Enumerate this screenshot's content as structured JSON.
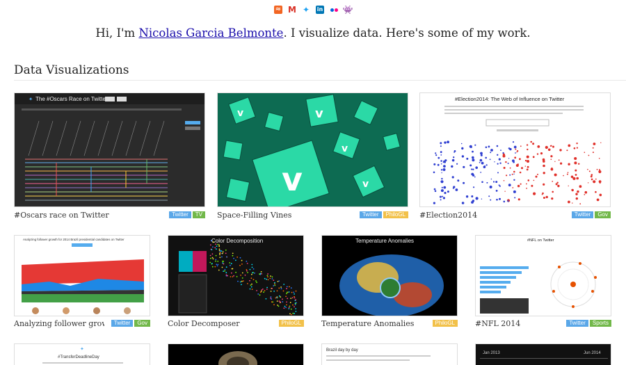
{
  "social": {
    "items": [
      {
        "name": "rss-icon",
        "glyph": "≈"
      },
      {
        "name": "gmail-icon",
        "glyph": "M"
      },
      {
        "name": "twitter-icon",
        "glyph": "✦"
      },
      {
        "name": "linkedin-icon",
        "glyph": "in"
      },
      {
        "name": "flickr-icon",
        "glyph": ""
      },
      {
        "name": "invader-icon",
        "glyph": "👾"
      }
    ]
  },
  "intro": {
    "prefix": "Hi, I'm ",
    "name": "Nicolas Garcia Belmonte",
    "suffix": ". I visualize data. Here's some of my work."
  },
  "section": {
    "title": "Data Visualizations"
  },
  "cards": [
    {
      "caption": "#Oscars race on Twitter",
      "tags": [
        {
          "label": "Twitter",
          "color": "#5aa7e8"
        },
        {
          "label": "TV",
          "color": "#72b84a"
        }
      ],
      "thumb_title": "The #Oscars Race on Twitter"
    },
    {
      "caption": "Space-Filling Vines",
      "tags": [
        {
          "label": "Twitter",
          "color": "#5aa7e8"
        },
        {
          "label": "PhiloGL",
          "color": "#f2c14a"
        }
      ],
      "thumb_title": ""
    },
    {
      "caption": "#Election2014",
      "tags": [
        {
          "label": "Twitter",
          "color": "#5aa7e8"
        },
        {
          "label": "Gov",
          "color": "#72b84a"
        }
      ],
      "thumb_title": "#Election2014: The Web of Influence on Twitter"
    },
    {
      "caption": "Analyzing follower growt…",
      "tags": [
        {
          "label": "Twitter",
          "color": "#5aa7e8"
        },
        {
          "label": "Gov",
          "color": "#72b84a"
        }
      ],
      "thumb_title": "Analyzing follower growth for 2014 Brazil presidential candidates on Twitter"
    },
    {
      "caption": "Color Decomposer",
      "tags": [
        {
          "label": "PhiloGL",
          "color": "#f2c14a"
        }
      ],
      "thumb_title": "Color Decomposition"
    },
    {
      "caption": "Temperature Anomalies",
      "tags": [
        {
          "label": "PhiloGL",
          "color": "#f2c14a"
        }
      ],
      "thumb_title": "Temperature Anomalies"
    },
    {
      "caption": "#NFL 2014",
      "tags": [
        {
          "label": "Twitter",
          "color": "#5aa7e8"
        },
        {
          "label": "Sports",
          "color": "#72b84a"
        }
      ],
      "thumb_title": "#NFL on Twitter"
    },
    {
      "caption": "",
      "tags": [],
      "thumb_title": "#TransferDeadlineDay"
    },
    {
      "caption": "",
      "tags": [],
      "thumb_title": ""
    },
    {
      "caption": "",
      "tags": [],
      "thumb_title": "Brazil day by day"
    },
    {
      "caption": "",
      "tags": [],
      "thumb_title": "",
      "axis_left": "Jan 2013",
      "axis_right": "Jun 2014"
    }
  ]
}
